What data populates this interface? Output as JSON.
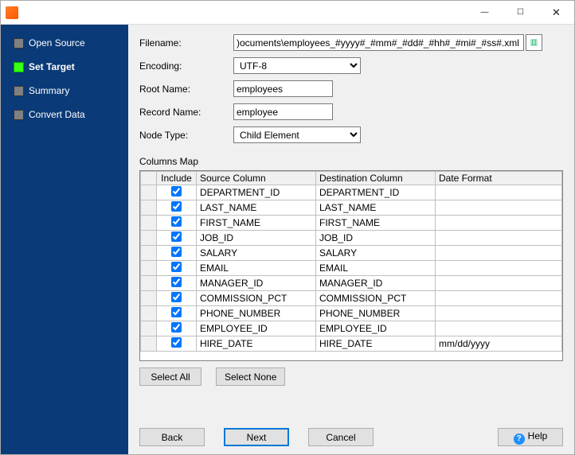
{
  "window": {
    "min_icon": "—",
    "max_icon": "☐",
    "close_icon": "✕"
  },
  "sidebar": {
    "items": [
      {
        "label": "Open Source",
        "active": false
      },
      {
        "label": "Set Target",
        "active": true
      },
      {
        "label": "Summary",
        "active": false
      },
      {
        "label": "Convert Data",
        "active": false
      }
    ]
  },
  "form": {
    "filename_label": "Filename:",
    "filename_value": ")ocuments\\employees_#yyyy#_#mm#_#dd#_#hh#_#mi#_#ss#.xml",
    "encoding_label": "Encoding:",
    "encoding_value": "UTF-8",
    "rootname_label": "Root Name:",
    "rootname_value": "employees",
    "recordname_label": "Record Name:",
    "recordname_value": "employee",
    "nodetype_label": "Node Type:",
    "nodetype_value": "Child Element"
  },
  "columns": {
    "title": "Columns Map",
    "headers": {
      "include": "Include",
      "src": "Source Column",
      "dst": "Destination Column",
      "dfmt": "Date Format"
    },
    "rows": [
      {
        "include": true,
        "src": "DEPARTMENT_ID",
        "dst": "DEPARTMENT_ID",
        "dfmt": ""
      },
      {
        "include": true,
        "src": "LAST_NAME",
        "dst": "LAST_NAME",
        "dfmt": ""
      },
      {
        "include": true,
        "src": "FIRST_NAME",
        "dst": "FIRST_NAME",
        "dfmt": ""
      },
      {
        "include": true,
        "src": "JOB_ID",
        "dst": "JOB_ID",
        "dfmt": ""
      },
      {
        "include": true,
        "src": "SALARY",
        "dst": "SALARY",
        "dfmt": ""
      },
      {
        "include": true,
        "src": "EMAIL",
        "dst": "EMAIL",
        "dfmt": ""
      },
      {
        "include": true,
        "src": "MANAGER_ID",
        "dst": "MANAGER_ID",
        "dfmt": ""
      },
      {
        "include": true,
        "src": "COMMISSION_PCT",
        "dst": "COMMISSION_PCT",
        "dfmt": ""
      },
      {
        "include": true,
        "src": "PHONE_NUMBER",
        "dst": "PHONE_NUMBER",
        "dfmt": ""
      },
      {
        "include": true,
        "src": "EMPLOYEE_ID",
        "dst": "EMPLOYEE_ID",
        "dfmt": ""
      },
      {
        "include": true,
        "src": "HIRE_DATE",
        "dst": "HIRE_DATE",
        "dfmt": "mm/dd/yyyy"
      }
    ]
  },
  "buttons": {
    "select_all": "Select All",
    "select_none": "Select None",
    "back": "Back",
    "next": "Next",
    "cancel": "Cancel",
    "help": "Help"
  }
}
